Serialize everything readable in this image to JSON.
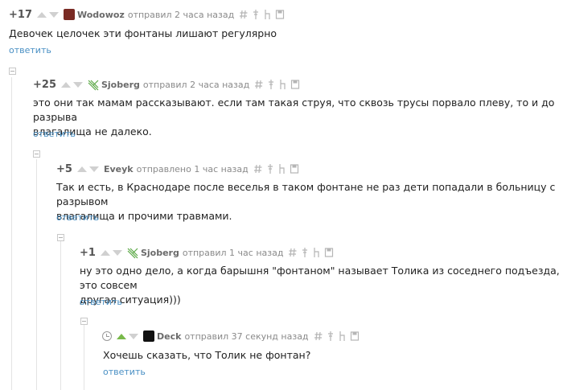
{
  "comments": [
    {
      "rating": "+17",
      "author": "Wodowoz",
      "meta": "отправил 2 часа назад",
      "text": "Девочек целочек эти фонтаны лишают регулярно",
      "reply": "ответить"
    },
    {
      "rating": "+25",
      "author": "Sjoberg",
      "meta": "отправил 2 часа назад",
      "text_line1": "это они так мамам рассказывают. если там такая струя, что сквозь трусы порвало плеву, то и до разрыва",
      "text_line2": "влагалища не далеко.",
      "reply": "ответить"
    },
    {
      "rating": "+5",
      "author": "Eveyk",
      "meta": "отправлено 1 час назад",
      "text_line1": "Так и есть, в Краснодаре после веселья в таком фонтане не раз дети попадали в больницу с разрывом",
      "text_line2": "влагалища и прочими травмами.",
      "reply": "ответить"
    },
    {
      "rating": "+1",
      "author": "Sjoberg",
      "meta": "отправил 1 час назад",
      "text_line1": "ну это одно дело, а когда барышня \"фонтаном\" называет Толика из соседнего подъезда, это совсем",
      "text_line2": "другая ситуация)))",
      "reply": "ответить"
    },
    {
      "rating": "",
      "author": "Deck",
      "meta": "отправил 37 секунд назад",
      "text": "Хочешь сказать, что Толик не фонтан?",
      "reply": "ответить"
    }
  ],
  "icons": {
    "tools": [
      "hash-icon",
      "pin-icon",
      "parent-icon",
      "save-icon"
    ],
    "accent": "#4a90c4",
    "upvote_active": "#78b94a"
  }
}
